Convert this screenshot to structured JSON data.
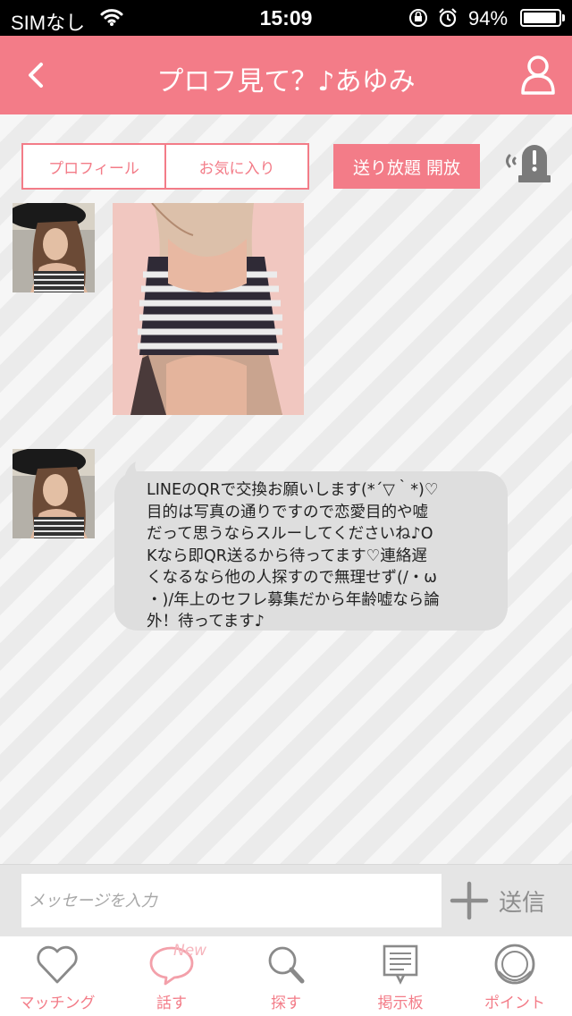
{
  "status_bar": {
    "carrier": "SIMなし",
    "time": "15:09",
    "battery": "94%",
    "battery_level": 0.94
  },
  "header": {
    "title": "プロフ見て？♪あゆみ",
    "back_icon": "chevron-left-icon",
    "profile_icon": "person-outline-icon"
  },
  "toolbar": {
    "tabs": [
      "プロフィール",
      "お気に入り"
    ],
    "open_button": "送り放題 開放",
    "report_icon": "alert-siren-icon"
  },
  "messages": [
    {
      "type": "image",
      "sender": "avatar",
      "content": "photo"
    },
    {
      "type": "text",
      "sender": "avatar",
      "text": "LINEのQRで交換お願いします(*´▽｀*)♡\n目的は写真の通りですので恋愛目的や嘘\nだって思うならスルーしてくださいね♪O\nKなら即QR送るから待ってます♡連絡遅\nくなるなら他の人探すので無理せず(/・ω\n・)/年上のセフレ募集だから年齢嘘なら論\n外！待ってます♪"
    }
  ],
  "composer": {
    "placeholder": "メッセージを入力",
    "send_label": "送信",
    "plus_icon": "plus-icon"
  },
  "tab_bar": {
    "items": [
      {
        "label": "マッチング",
        "icon": "heart-icon"
      },
      {
        "label": "話す",
        "icon": "speech-bubble-icon",
        "badge": "New"
      },
      {
        "label": "探す",
        "icon": "search-icon"
      },
      {
        "label": "掲示板",
        "icon": "board-icon"
      },
      {
        "label": "ポイント",
        "icon": "coin-icon"
      }
    ]
  },
  "colors": {
    "accent": "#f37c88",
    "bubble": "#dedede"
  }
}
